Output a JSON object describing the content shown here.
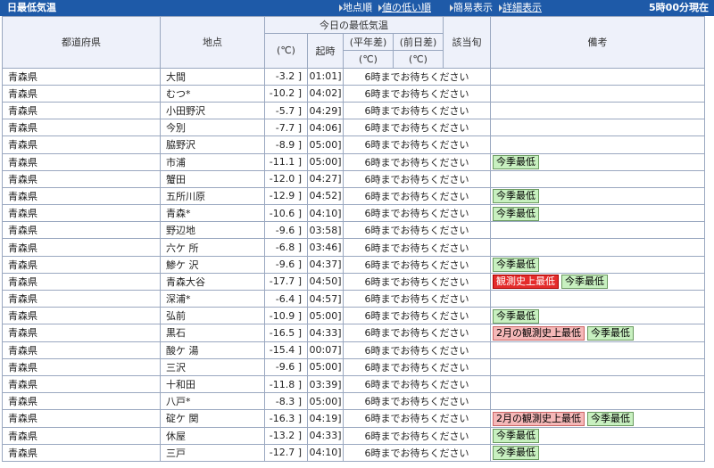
{
  "titlebar": {
    "title": "日最低気温",
    "nav": [
      "地点順",
      "値の低い順",
      "簡易表示",
      "詳細表示"
    ],
    "updated": "5時00分現在"
  },
  "headers": {
    "pref": "都道府県",
    "loc": "地点",
    "group": "今日の最低気温",
    "unit": "(℃)",
    "time": "起時",
    "normal1": "(平年差)",
    "normal2": "(℃)",
    "prev1": "(前日差)",
    "prev2": "(℃)",
    "decade": "該当旬",
    "notes": "備考"
  },
  "wait_text": "6時までお待ちください",
  "badges": {
    "season_min": "今季最低",
    "record_min": "観測史上最低",
    "feb_record_min": "2月の観測史上最低"
  },
  "rows": [
    {
      "pref": "青森県",
      "loc": "大間",
      "val": "-3.2 ]",
      "time": "01:01]",
      "badges": []
    },
    {
      "pref": "青森県",
      "loc": "むつ*",
      "val": "-10.2 ]",
      "time": "04:02]",
      "badges": []
    },
    {
      "pref": "青森県",
      "loc": "小田野沢",
      "val": "-5.7 ]",
      "time": "04:29]",
      "badges": []
    },
    {
      "pref": "青森県",
      "loc": "今別",
      "val": "-7.7 ]",
      "time": "04:06]",
      "badges": []
    },
    {
      "pref": "青森県",
      "loc": "脇野沢",
      "val": "-8.9 ]",
      "time": "05:00]",
      "badges": []
    },
    {
      "pref": "青森県",
      "loc": "市浦",
      "val": "-11.1 ]",
      "time": "05:00]",
      "badges": [
        "season_min"
      ]
    },
    {
      "pref": "青森県",
      "loc": "蟹田",
      "val": "-12.0 ]",
      "time": "04:27]",
      "badges": []
    },
    {
      "pref": "青森県",
      "loc": "五所川原",
      "val": "-12.9 ]",
      "time": "04:52]",
      "badges": [
        "season_min"
      ]
    },
    {
      "pref": "青森県",
      "loc": "青森*",
      "val": "-10.6 ]",
      "time": "04:10]",
      "badges": [
        "season_min"
      ]
    },
    {
      "pref": "青森県",
      "loc": "野辺地",
      "val": "-9.6 ]",
      "time": "03:58]",
      "badges": []
    },
    {
      "pref": "青森県",
      "loc": "六ケ 所",
      "val": "-6.8 ]",
      "time": "03:46]",
      "badges": []
    },
    {
      "pref": "青森県",
      "loc": "鯵ケ 沢",
      "val": "-9.6 ]",
      "time": "04:37]",
      "badges": [
        "season_min"
      ]
    },
    {
      "pref": "青森県",
      "loc": "青森大谷",
      "val": "-17.7 ]",
      "time": "04:50]",
      "badges": [
        "record_min",
        "season_min"
      ]
    },
    {
      "pref": "青森県",
      "loc": "深浦*",
      "val": "-6.4 ]",
      "time": "04:57]",
      "badges": []
    },
    {
      "pref": "青森県",
      "loc": "弘前",
      "val": "-10.9 ]",
      "time": "05:00]",
      "badges": [
        "season_min"
      ]
    },
    {
      "pref": "青森県",
      "loc": "黒石",
      "val": "-16.5 ]",
      "time": "04:33]",
      "badges": [
        "feb_record_min",
        "season_min"
      ]
    },
    {
      "pref": "青森県",
      "loc": "酸ケ 湯",
      "val": "-15.4 ]",
      "time": "00:07]",
      "badges": []
    },
    {
      "pref": "青森県",
      "loc": "三沢",
      "val": "-9.6 ]",
      "time": "05:00]",
      "badges": []
    },
    {
      "pref": "青森県",
      "loc": "十和田",
      "val": "-11.8 ]",
      "time": "03:39]",
      "badges": []
    },
    {
      "pref": "青森県",
      "loc": "八戸*",
      "val": "-8.3 ]",
      "time": "05:00]",
      "badges": []
    },
    {
      "pref": "青森県",
      "loc": "碇ケ 関",
      "val": "-16.3 ]",
      "time": "04:19]",
      "badges": [
        "feb_record_min",
        "season_min"
      ]
    },
    {
      "pref": "青森県",
      "loc": "休屋",
      "val": "-13.2 ]",
      "time": "04:33]",
      "badges": [
        "season_min"
      ]
    },
    {
      "pref": "青森県",
      "loc": "三戸",
      "val": "-12.7 ]",
      "time": "04:10]",
      "badges": [
        "season_min"
      ]
    }
  ]
}
